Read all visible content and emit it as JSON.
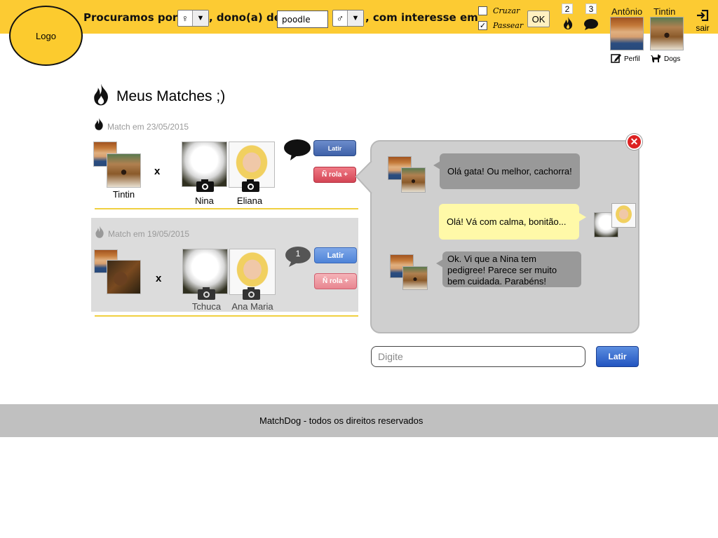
{
  "header": {
    "logo": "Logo",
    "search_prefix": "Procuramos por",
    "gender_female": "♀",
    "owner_text": ", dono(a) de",
    "breed_value": "poodle",
    "gender_male": "♂",
    "interest_text": ", com interesse em",
    "option_cruzar": "Cruzar",
    "option_passear": "Passear",
    "option_cruzar_checked": "",
    "option_passear_checked": "✓",
    "ok_label": "OK",
    "matches_count": "2",
    "messages_count": "3",
    "user_name": "Antônio",
    "dog_name": "Tintin",
    "profile_link": "Perfil",
    "dogs_link": "Dogs",
    "logout_label": "sair"
  },
  "page": {
    "title": "Meus Matches ;)"
  },
  "matches": [
    {
      "date": "Match em 23/05/2015",
      "my_dog": "Tintin",
      "vs": "x",
      "their_dog": "Nina",
      "their_owner": "Eliana",
      "action_primary": "Latir",
      "action_secondary": "Ñ rola +"
    },
    {
      "date": "Match em 19/05/2015",
      "my_dog": "",
      "vs": "x",
      "their_dog": "Tchuca",
      "their_owner": "Ana Maria",
      "unread": "1",
      "action_primary": "Latir",
      "action_secondary": "Ñ rola +"
    }
  ],
  "chat": {
    "messages": [
      {
        "side": "left",
        "text": "Olá gata! Ou melhor, cachorra!"
      },
      {
        "side": "right",
        "text": "Olá! Vá com calma, bonitão..."
      },
      {
        "side": "left",
        "text": "Ok. Vi que a Nina tem pedigree! Parece ser muito bem cuidada. Parabéns!"
      }
    ],
    "input_placeholder": "Digite",
    "send_label": "Latir"
  },
  "footer": {
    "text": "MatchDog - todos os direitos reservados"
  },
  "colors": {
    "header_bg": "#fccb33",
    "footer_bg": "#c0c0c0",
    "chat_bg": "#cfcfcf",
    "bubble_gray": "#999999",
    "bubble_yellow": "#fff9a8"
  }
}
